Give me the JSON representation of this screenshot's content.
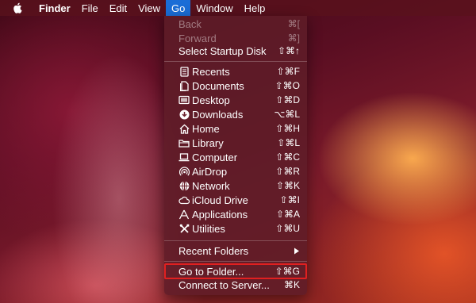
{
  "menubar": {
    "apple_icon": "apple-logo-icon",
    "items": [
      {
        "label": "Finder"
      },
      {
        "label": "File"
      },
      {
        "label": "Edit"
      },
      {
        "label": "View"
      },
      {
        "label": "Go"
      },
      {
        "label": "Window"
      },
      {
        "label": "Help"
      }
    ],
    "active_item": "Go"
  },
  "go_menu": {
    "items": [
      {
        "label": "Back",
        "shortcut": "⌘[",
        "enabled": false
      },
      {
        "label": "Forward",
        "shortcut": "⌘]",
        "enabled": false
      },
      {
        "label": "Select Startup Disk",
        "shortcut": "⇧⌘↑",
        "enabled": true
      },
      {
        "label": "Recents",
        "shortcut": "⇧⌘F",
        "icon": "recents-icon"
      },
      {
        "label": "Documents",
        "shortcut": "⇧⌘O",
        "icon": "documents-icon"
      },
      {
        "label": "Desktop",
        "shortcut": "⇧⌘D",
        "icon": "desktop-icon"
      },
      {
        "label": "Downloads",
        "shortcut": "⌥⌘L",
        "icon": "downloads-icon"
      },
      {
        "label": "Home",
        "shortcut": "⇧⌘H",
        "icon": "home-icon"
      },
      {
        "label": "Library",
        "shortcut": "⇧⌘L",
        "icon": "library-icon"
      },
      {
        "label": "Computer",
        "shortcut": "⇧⌘C",
        "icon": "computer-icon"
      },
      {
        "label": "AirDrop",
        "shortcut": "⇧⌘R",
        "icon": "airdrop-icon"
      },
      {
        "label": "Network",
        "shortcut": "⇧⌘K",
        "icon": "network-icon"
      },
      {
        "label": "iCloud Drive",
        "shortcut": "⇧⌘I",
        "icon": "icloud-icon"
      },
      {
        "label": "Applications",
        "shortcut": "⇧⌘A",
        "icon": "applications-icon"
      },
      {
        "label": "Utilities",
        "shortcut": "⇧⌘U",
        "icon": "utilities-icon"
      },
      {
        "label": "Recent Folders",
        "submenu_icon": "submenu-arrow-icon"
      },
      {
        "label": "Go to Folder...",
        "shortcut": "⇧⌘G",
        "highlighted": true
      },
      {
        "label": "Connect to Server...",
        "shortcut": "⌘K"
      }
    ]
  },
  "colors": {
    "menubar_bg": "#5a121c",
    "menu_bg": "#5f1c28",
    "active_item": "#1a6dd6",
    "highlight_border": "#e02020",
    "text": "#ffffff"
  }
}
